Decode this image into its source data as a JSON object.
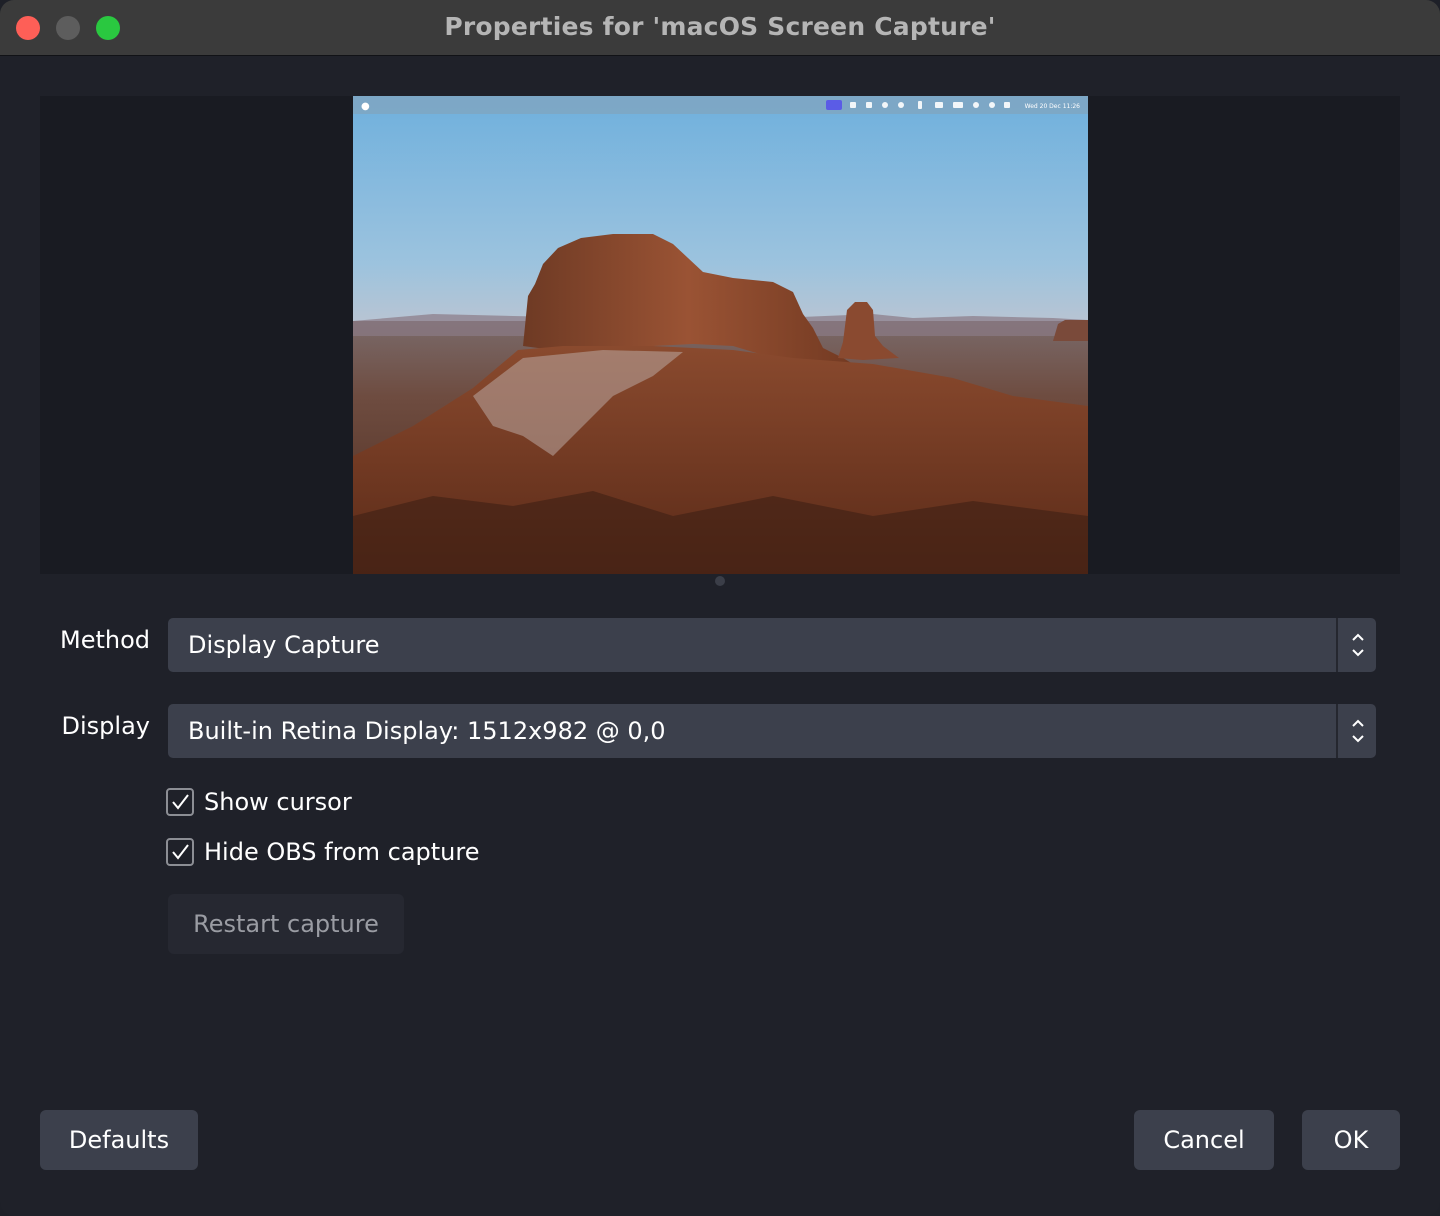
{
  "window": {
    "title": "Properties for 'macOS Screen Capture'"
  },
  "preview": {
    "menubar_clock": "Wed 20 Dec  11:26"
  },
  "form": {
    "method": {
      "label": "Method",
      "value": "Display Capture"
    },
    "display": {
      "label": "Display",
      "value": "Built-in Retina Display: 1512x982 @ 0,0"
    },
    "show_cursor": {
      "label": "Show cursor",
      "checked": true
    },
    "hide_obs": {
      "label": "Hide OBS from capture",
      "checked": true
    },
    "restart_label": "Restart capture"
  },
  "footer": {
    "defaults_label": "Defaults",
    "cancel_label": "Cancel",
    "ok_label": "OK"
  },
  "colors": {
    "window_bg": "#1f2129",
    "titlebar": "#3b3b3b",
    "control_bg": "#3c404c",
    "close": "#fe5f57",
    "minimize": "#5d5d5d",
    "maximize": "#2ac840"
  }
}
